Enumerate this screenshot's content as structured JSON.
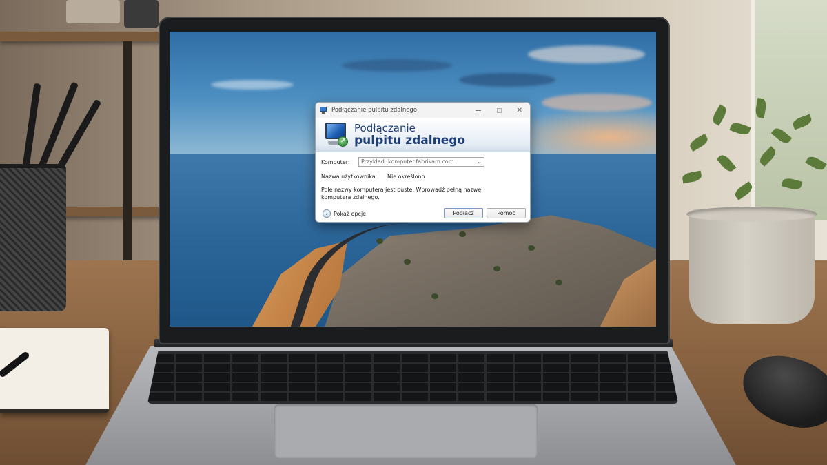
{
  "dialog": {
    "titlebar": {
      "title": "Podłączanie pulpitu zdalnego",
      "minimize_glyph": "—",
      "close_glyph": "✕"
    },
    "banner": {
      "line1": "Podłączanie",
      "line2": "pulpitu zdalnego"
    },
    "computer": {
      "label": "Komputer:",
      "placeholder": "Przykład: komputer.fabrikam.com",
      "dropdown_glyph": "⌄"
    },
    "username": {
      "label": "Nazwa użytkownika:",
      "value": "Nie określono"
    },
    "message": "Pole nazwy komputera jest puste. Wprowadź pełną nazwę komputera zdalnego.",
    "options": {
      "glyph": "⌄",
      "label": "Pokaż opcje"
    },
    "buttons": {
      "connect": "Podłącz",
      "help": "Pomoc"
    }
  },
  "icons": {
    "title_icon": "remote-desktop-icon",
    "banner_icon": "remote-desktop-connection-icon",
    "options_icon": "chevron-down-circle-icon"
  },
  "colors": {
    "banner_text": "#1f3f7a",
    "dialog_bg": "#ffffff",
    "titlebar_bg": "#f3f3f3"
  }
}
